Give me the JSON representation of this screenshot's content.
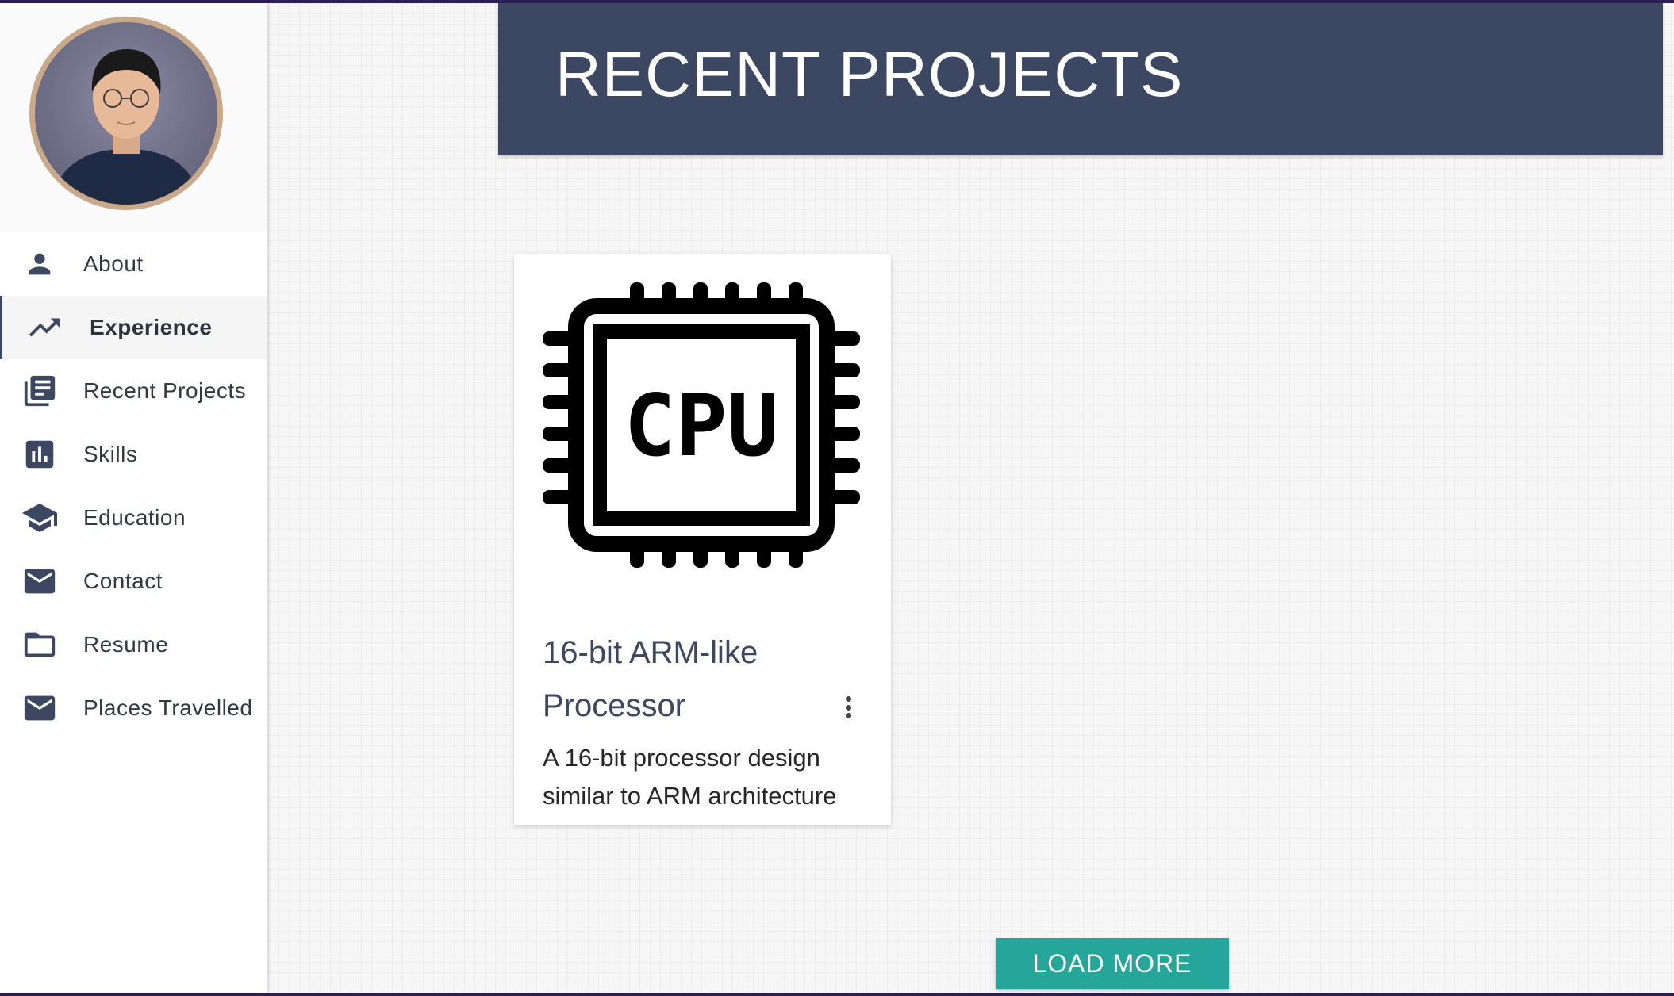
{
  "sidebar": {
    "items": [
      {
        "label": "About",
        "icon": "person-icon",
        "active": false
      },
      {
        "label": "Experience",
        "icon": "trending-up-icon",
        "active": true
      },
      {
        "label": "Recent Projects",
        "icon": "library-books-icon",
        "active": false
      },
      {
        "label": "Skills",
        "icon": "bar-chart-icon",
        "active": false
      },
      {
        "label": "Education",
        "icon": "school-icon",
        "active": false
      },
      {
        "label": "Contact",
        "icon": "mail-icon",
        "active": false
      },
      {
        "label": "Resume",
        "icon": "folder-icon",
        "active": false
      },
      {
        "label": "Places Travelled",
        "icon": "mail-icon",
        "active": false
      }
    ]
  },
  "header": {
    "title": "RECENT PROJECTS"
  },
  "projects": [
    {
      "image_icon": "cpu-icon",
      "image_text": "CPU",
      "title": "16-bit ARM-like Processor",
      "description": "A 16-bit processor design similar to ARM architecture"
    }
  ],
  "load_more_label": "LOAD MORE",
  "colors": {
    "primary": "#3c4761",
    "accent": "#26a69a",
    "avatar_ring": "#c9a98a"
  }
}
